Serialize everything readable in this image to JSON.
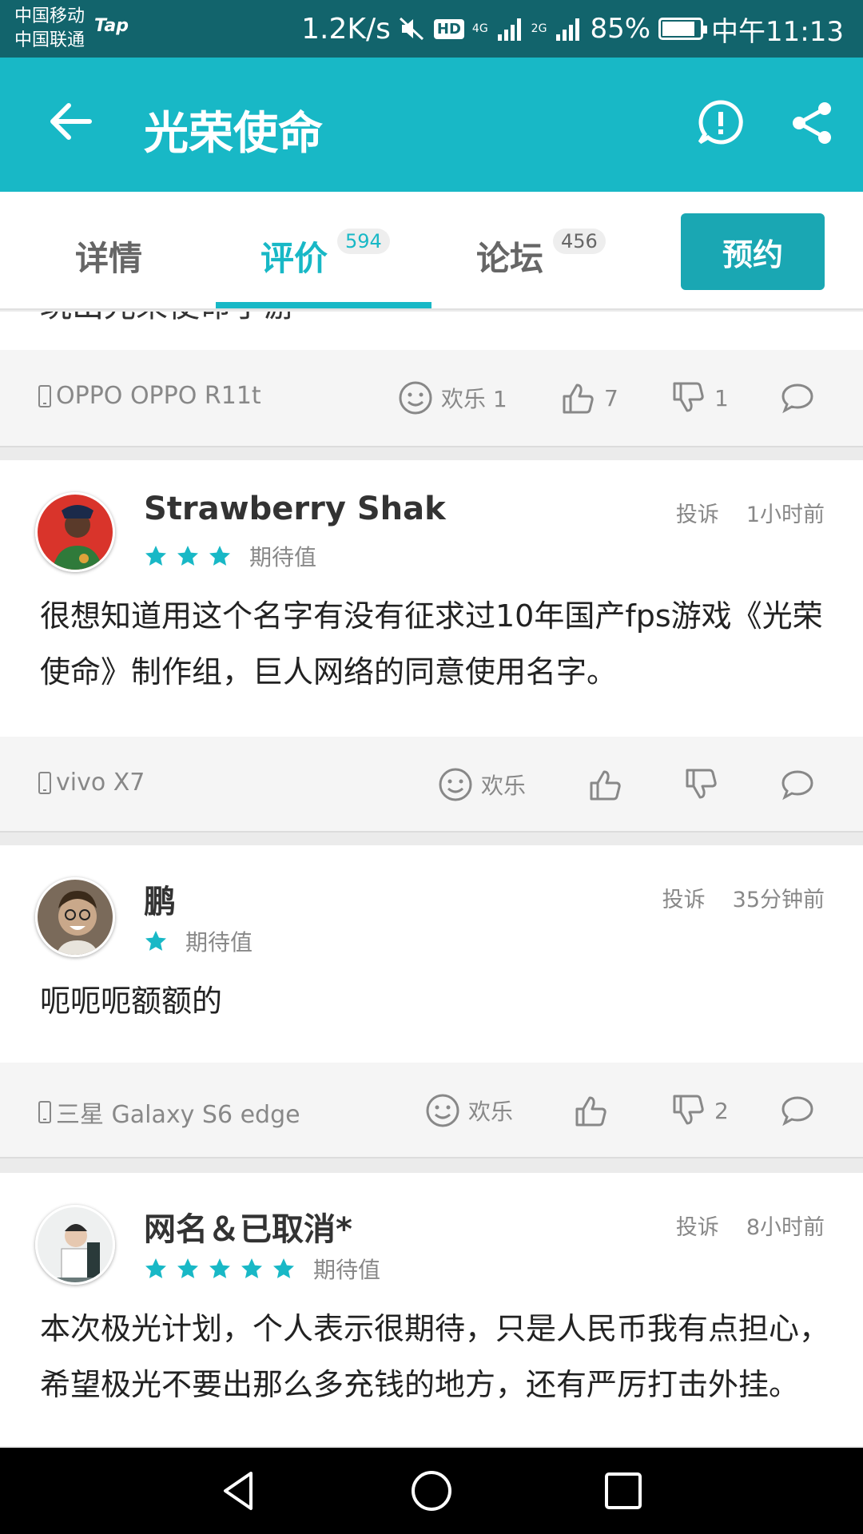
{
  "status_bar": {
    "carrier1": "中国移动",
    "carrier2": "中国联通",
    "tap": "Tap",
    "speed": "1.2K/s",
    "net1": "4G",
    "net2": "2G",
    "battery": "85%",
    "time": "中午11:13"
  },
  "app_bar": {
    "title": "光荣使命"
  },
  "tabs": {
    "details": "详情",
    "reviews": "评价",
    "reviews_count": "594",
    "forum": "论坛",
    "forum_count": "456",
    "reserve": "预约"
  },
  "cut_review": {
    "text": "玩出光荣使命手游",
    "device": "OPPO OPPO R11t",
    "fun": "欢乐 1",
    "likes": "7",
    "dislikes": "1"
  },
  "reviews": [
    {
      "name": "Strawberry Shak",
      "report": "投诉",
      "time": "1小时前",
      "stars": 3,
      "rating_label": "期待值",
      "text": "很想知道用这个名字有没有征求过10年国产fps游戏《光荣使命》制作组，巨人网络的同意使用名字。",
      "device": "vivo X7",
      "fun": "欢乐",
      "likes": "",
      "dislikes": ""
    },
    {
      "name": "鹏",
      "report": "投诉",
      "time": "35分钟前",
      "stars": 1,
      "rating_label": "期待值",
      "text": "呃呃呃额额的",
      "device": "三星 Galaxy S6 edge",
      "fun": "欢乐",
      "likes": "",
      "dislikes": "2"
    },
    {
      "name": "网名＆已取消*",
      "report": "投诉",
      "time": "8小时前",
      "stars": 5,
      "rating_label": "期待值",
      "text": "本次极光计划，个人表示很期待，只是人民币我有点担心，希望极光不要出那么多充钱的地方，还有严厉打击外挂。"
    }
  ],
  "colors": {
    "accent": "#18b8c6",
    "status_bar": "#12646c",
    "reserve": "#1aa7b3"
  }
}
